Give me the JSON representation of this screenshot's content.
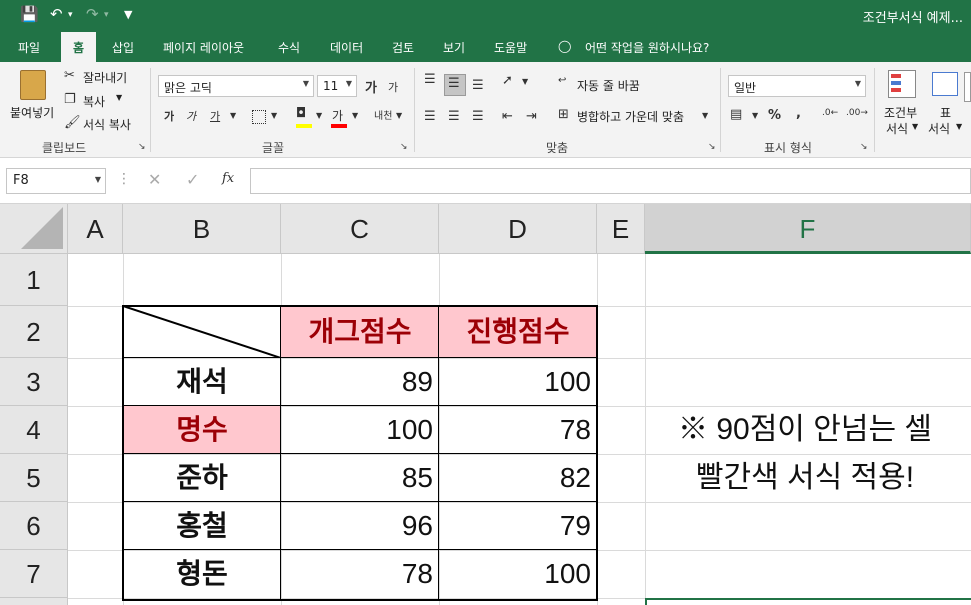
{
  "titlebar": {
    "title": "조건부서식 예제..."
  },
  "ribbon_tabs": [
    "파일",
    "홈",
    "삽입",
    "페이지 레이아웃",
    "수식",
    "데이터",
    "검토",
    "보기",
    "도움말"
  ],
  "tell_me": "어떤 작업을 원하시나요?",
  "clipboard": {
    "paste": "붙여넣기",
    "cut": "잘라내기",
    "copy": "복사",
    "format_painter": "서식 복사",
    "group": "클립보드"
  },
  "font": {
    "name": "맑은 고딕",
    "size": "11",
    "bold": "가",
    "italic": "가",
    "underline": "가",
    "grow": "가",
    "shrink": "가",
    "color_glyph": "가",
    "phonetic": "내천",
    "group": "글꼴"
  },
  "alignment": {
    "wrap": "자동 줄 바꿈",
    "merge": "병합하고 가운데 맞춤",
    "group": "맞춤"
  },
  "number": {
    "format": "일반",
    "percent": "%",
    "comma": ",",
    "group": "표시 형식"
  },
  "styles": {
    "conditional": "조건부",
    "conditional2": "서식",
    "table": "표",
    "table2": "서식"
  },
  "namebox": "F8",
  "columns": [
    "A",
    "B",
    "C",
    "D",
    "E",
    "F"
  ],
  "rows": [
    "1",
    "2",
    "3",
    "4",
    "5",
    "6",
    "7"
  ],
  "table": {
    "headers": [
      "개그점수",
      "진행점수"
    ],
    "rows": [
      {
        "name": "재석",
        "c": "89",
        "d": "100"
      },
      {
        "name": "명수",
        "c": "100",
        "d": "78"
      },
      {
        "name": "준하",
        "c": "85",
        "d": "82"
      },
      {
        "name": "홍철",
        "c": "96",
        "d": "79"
      },
      {
        "name": "형돈",
        "c": "78",
        "d": "100"
      }
    ]
  },
  "note": {
    "line1": "※ 90점이 안넘는 셀",
    "line2": "빨간색 서식 적용!"
  },
  "colors": {
    "excel_green": "#217346",
    "highlight_fill": "#ffc7ce",
    "highlight_text": "#9c0006"
  }
}
